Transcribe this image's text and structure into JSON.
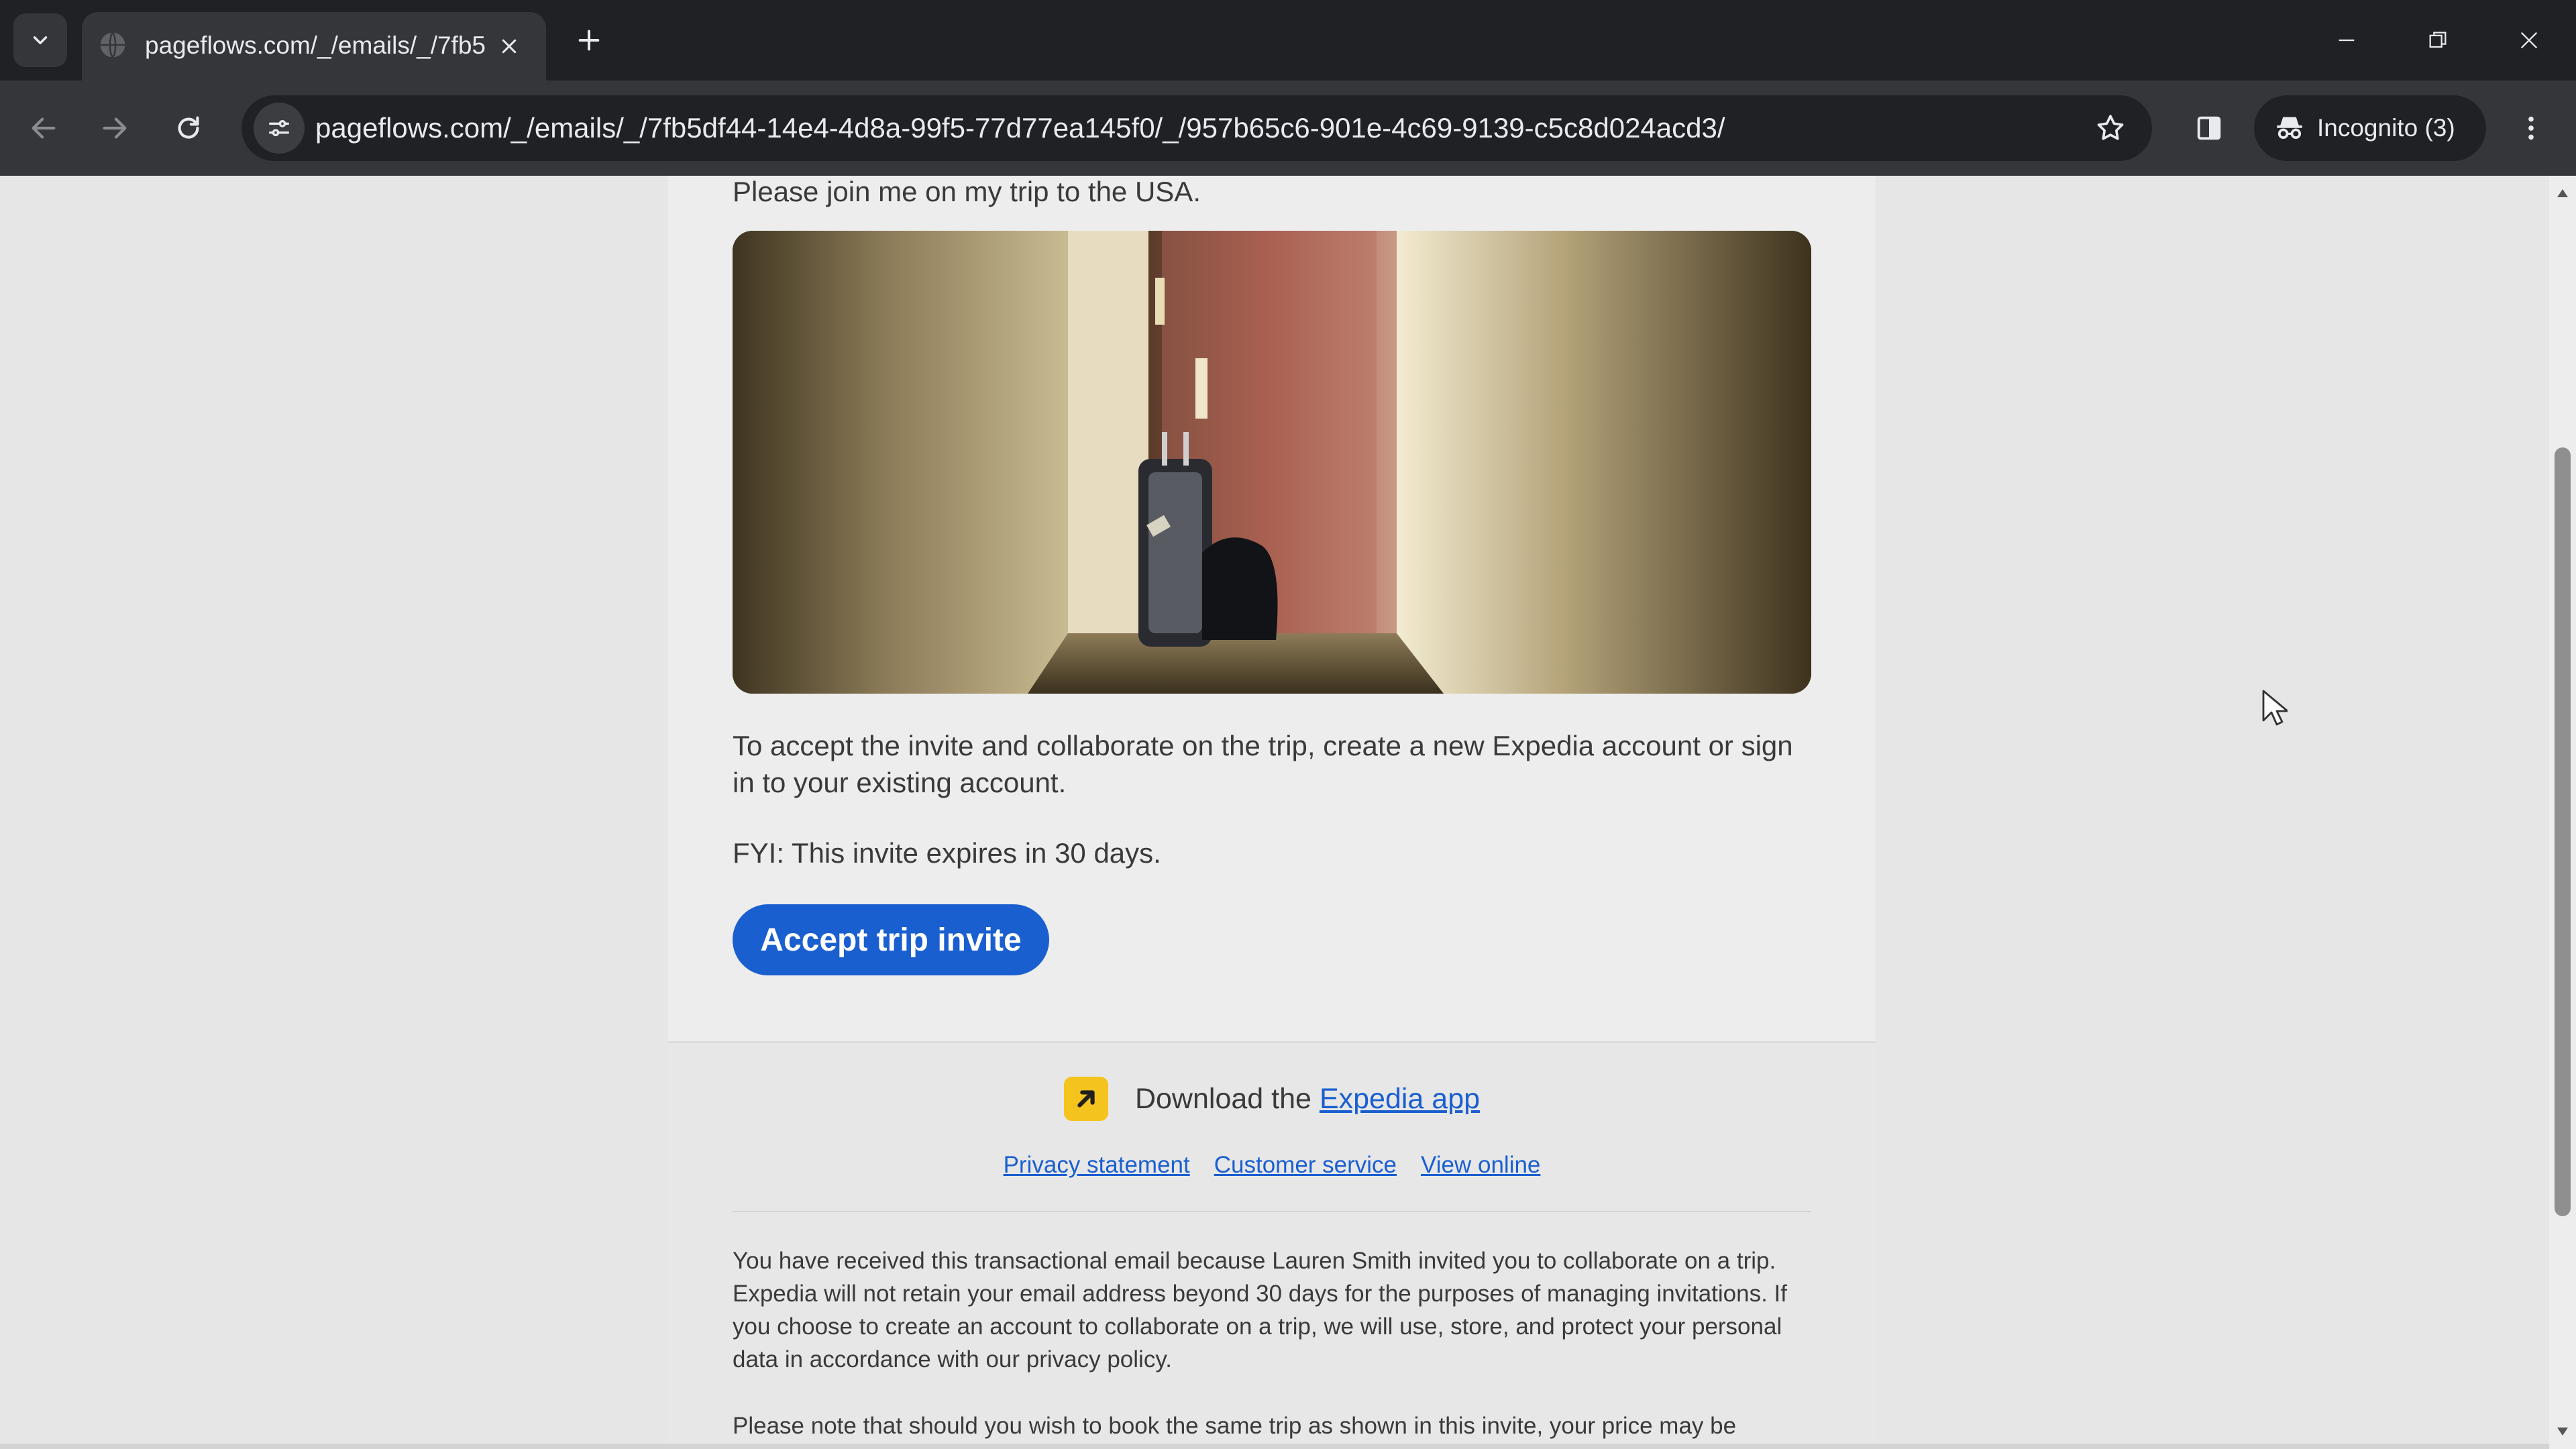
{
  "browser": {
    "tab_title": "pageflows.com/_/emails/_/7fb5",
    "url": "pageflows.com/_/emails/_/7fb5df44-14e4-4d8a-99f5-77d77ea145f0/_/957b65c6-901e-4c69-9139-c5c8d024acd3/",
    "incognito_label": "Incognito (3)",
    "icons": [
      "tab-search-icon",
      "globe-icon",
      "close-icon",
      "plus-icon",
      "minimize-icon",
      "restore-icon",
      "back-icon",
      "forward-icon",
      "reload-icon",
      "site-settings-icon",
      "star-icon",
      "side-panel-icon",
      "incognito-icon",
      "more-icon"
    ]
  },
  "email": {
    "greeting": "Please join me on my trip to the USA.",
    "invite_text": "To accept the invite and collaborate on the trip, create a new Expedia account or sign in to your existing account.",
    "expiry_text": "FYI: This invite expires in 30 days.",
    "accept_button": "Accept trip invite"
  },
  "footer": {
    "download_prefix": "Download the",
    "download_link": "Expedia app",
    "links": [
      "Privacy statement",
      "Customer service",
      "View online"
    ],
    "legal_1": "You have received this transactional email because Lauren Smith invited you to collaborate on a trip. Expedia will not retain your email address beyond 30 days for the purposes of managing invitations. If you choose to create an account to collaborate on a trip, we will use, store, and protect your personal data in accordance with our privacy policy.",
    "legal_2": "Please note that should you wish to book the same trip as shown in this invite, your price may be"
  },
  "colors": {
    "accent": "#1a5fd0",
    "brand_yellow": "#f5c31e",
    "chrome_dark": "#202124",
    "chrome_toolbar": "#35363a"
  }
}
